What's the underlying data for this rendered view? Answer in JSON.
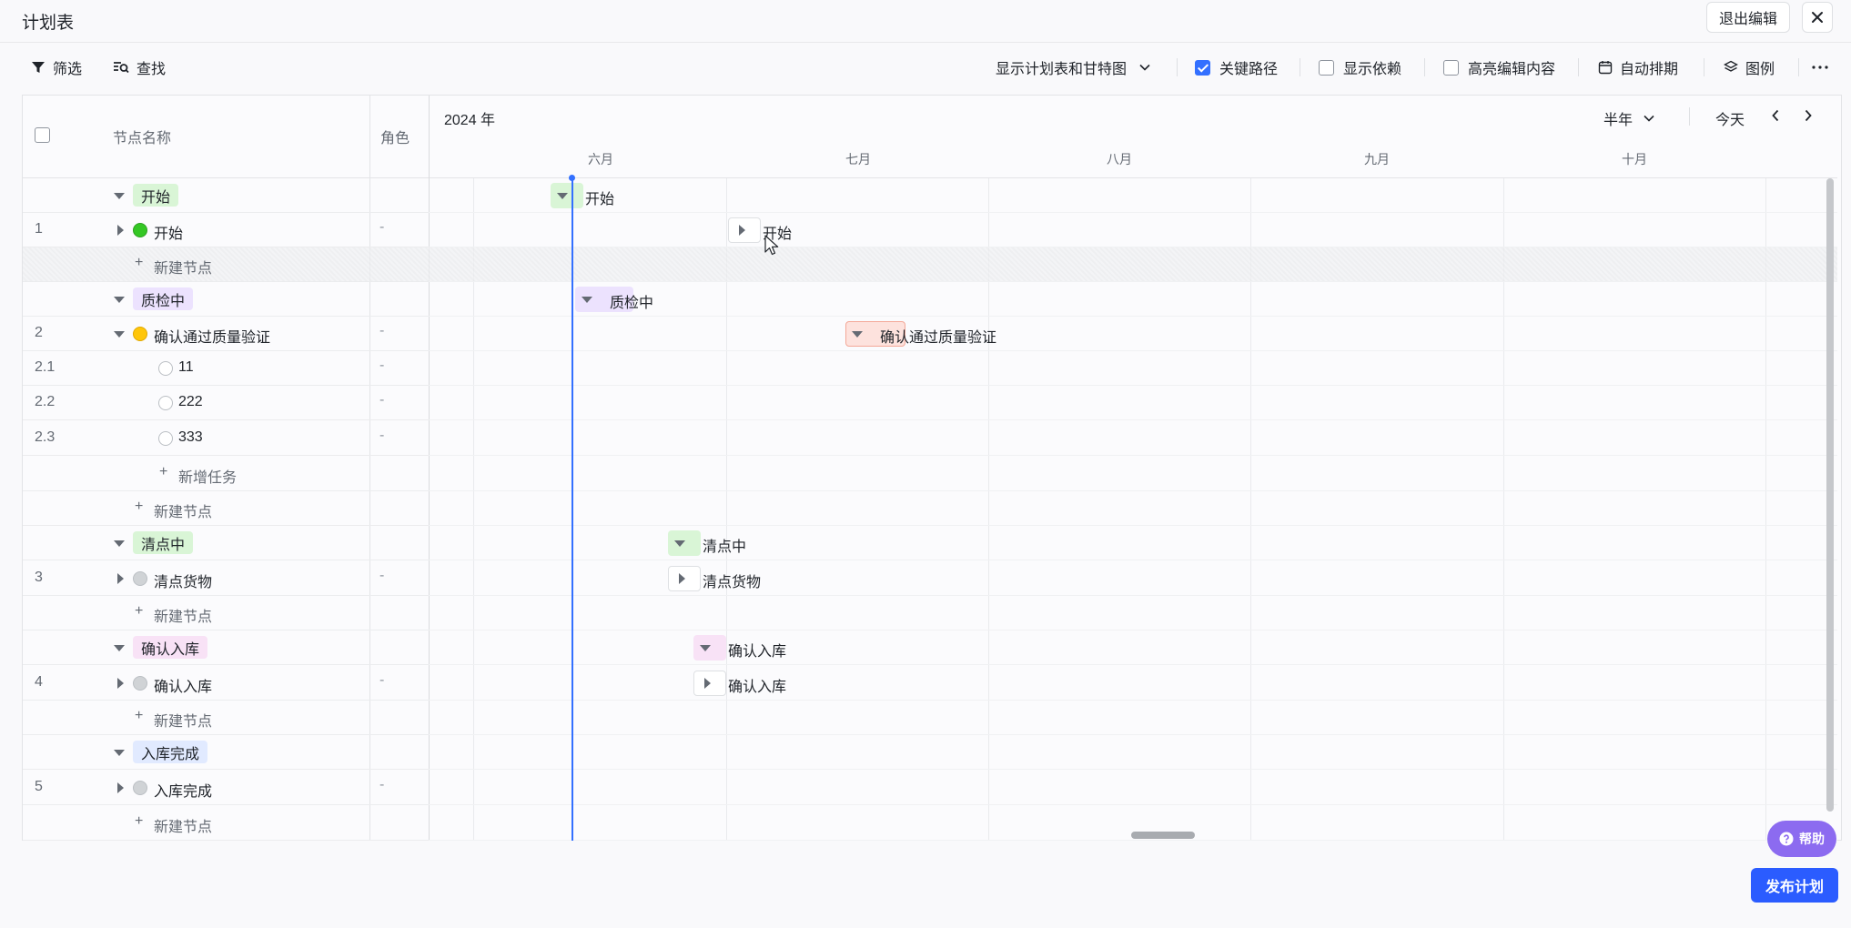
{
  "header": {
    "title": "计划表",
    "exit_edit": "退出编辑"
  },
  "toolbar": {
    "filter": "筛选",
    "search": "查找",
    "view_mode": "显示计划表和甘特图",
    "critical_path": {
      "label": "关键路径",
      "checked": true
    },
    "show_deps": {
      "label": "显示依赖",
      "checked": false
    },
    "highlight_edits": {
      "label": "高亮编辑内容",
      "checked": false
    },
    "auto_schedule": "自动排期",
    "legend": "图例"
  },
  "table": {
    "col_name": "节点名称",
    "col_role": "角色",
    "rows": [
      {
        "type": "group",
        "label": "开始",
        "tag": "green"
      },
      {
        "type": "node",
        "num": "1",
        "label": "开始",
        "status": "green",
        "role": "-"
      },
      {
        "type": "add",
        "label": "新建节点"
      },
      {
        "type": "group",
        "label": "质检中",
        "tag": "purple"
      },
      {
        "type": "node",
        "num": "2",
        "label": "确认通过质量验证",
        "status": "yellow",
        "role": "-"
      },
      {
        "type": "task",
        "num": "2.1",
        "label": "11",
        "role": "-"
      },
      {
        "type": "task",
        "num": "2.2",
        "label": "222",
        "role": "-"
      },
      {
        "type": "task",
        "num": "2.3",
        "label": "333",
        "role": "-"
      },
      {
        "type": "addtask",
        "label": "新增任务"
      },
      {
        "type": "add",
        "label": "新建节点"
      },
      {
        "type": "group",
        "label": "清点中",
        "tag": "green"
      },
      {
        "type": "node",
        "num": "3",
        "label": "清点货物",
        "status": "gray",
        "role": "-"
      },
      {
        "type": "add",
        "label": "新建节点"
      },
      {
        "type": "group",
        "label": "确认入库",
        "tag": "pink"
      },
      {
        "type": "node",
        "num": "4",
        "label": "确认入库",
        "status": "gray",
        "role": "-"
      },
      {
        "type": "add",
        "label": "新建节点"
      },
      {
        "type": "group",
        "label": "入库完成",
        "tag": "blue"
      },
      {
        "type": "node",
        "num": "5",
        "label": "入库完成",
        "status": "gray",
        "role": "-"
      },
      {
        "type": "add",
        "label": "新建节点"
      }
    ]
  },
  "gantt": {
    "year": "2024 年",
    "range": "半年",
    "today": "今天",
    "months": [
      "六月",
      "七月",
      "八月",
      "九月",
      "十月"
    ],
    "bars": [
      {
        "row": 0,
        "label": "开始",
        "color": "#d9f5d6"
      },
      {
        "row": 1,
        "label": "开始",
        "color": "#ffffff"
      },
      {
        "row": 3,
        "label": "质检中",
        "color": "#ece2fe"
      },
      {
        "row": 4,
        "label": "确认通过质量验证",
        "color": "#fde2dd"
      },
      {
        "row": 10,
        "label": "清点中",
        "color": "#d9f5d6"
      },
      {
        "row": 11,
        "label": "清点货物",
        "color": "#ffffff"
      },
      {
        "row": 13,
        "label": "确认入库",
        "color": "#f8e2f6"
      },
      {
        "row": 14,
        "label": "确认入库",
        "color": "#ffffff"
      }
    ]
  },
  "footer": {
    "help": "帮助",
    "publish": "发布计划"
  }
}
